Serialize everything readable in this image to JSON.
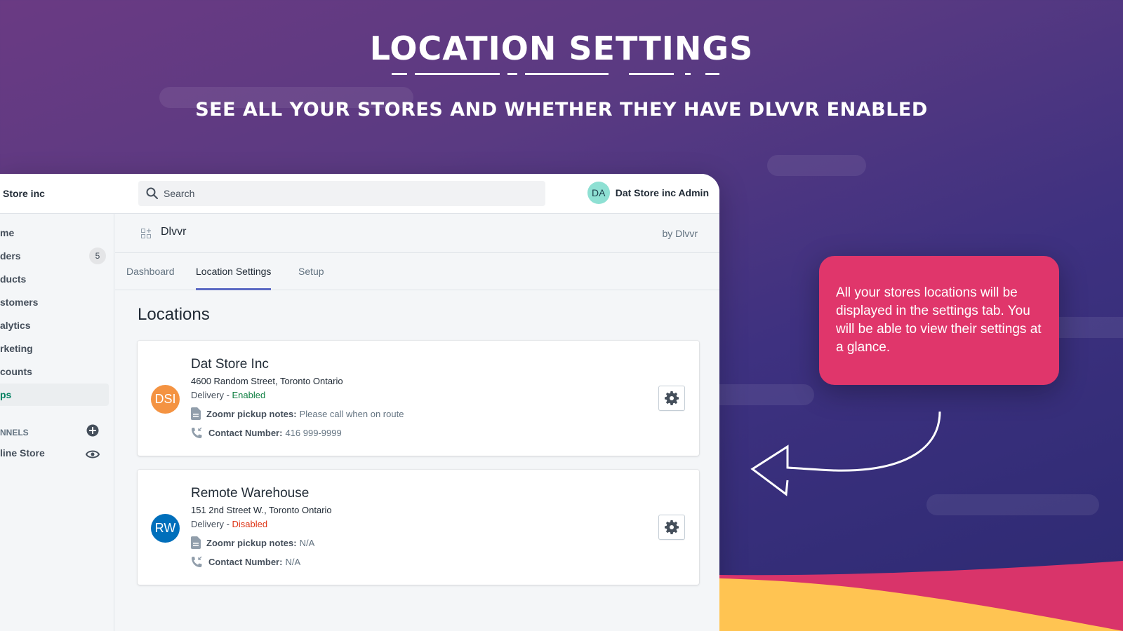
{
  "hero": {
    "title": "LOCATION SETTINGS",
    "subtitle": "SEE ALL YOUR STORES AND WHETHER THEY HAVE DLVVR ENABLED"
  },
  "topbar": {
    "store_name": "Store inc",
    "search_placeholder": "Search",
    "user_initials": "DA",
    "user_name": "Dat Store inc Admin"
  },
  "sidebar": {
    "items": [
      {
        "label": "me"
      },
      {
        "label": "ders",
        "badge": "5"
      },
      {
        "label": "ducts"
      },
      {
        "label": "stomers"
      },
      {
        "label": "alytics"
      },
      {
        "label": "rketing"
      },
      {
        "label": "counts"
      },
      {
        "label": "ps",
        "active": true
      }
    ],
    "section_label": "NNELS",
    "channel": "line Store"
  },
  "app": {
    "name": "Dlvvr",
    "by": "by Dlvvr",
    "tabs": [
      {
        "label": "Dashboard"
      },
      {
        "label": "Location Settings",
        "active": true
      },
      {
        "label": "Setup"
      }
    ],
    "page_title": "Locations",
    "locations": [
      {
        "initials": "DSI",
        "avatar_color": "#f49342",
        "name": "Dat Store Inc",
        "address": "4600 Random Street, Toronto Ontario",
        "delivery_label": "Delivery - ",
        "delivery_status": "Enabled",
        "notes_label": "Zoomr pickup notes:",
        "notes": "Please call when on route",
        "contact_label": "Contact Number:",
        "contact": "416 999-9999"
      },
      {
        "initials": "RW",
        "avatar_color": "#006fbb",
        "name": "Remote Warehouse",
        "address": "151 2nd Street W., Toronto Ontario",
        "delivery_label": "Delivery - ",
        "delivery_status": "Disabled",
        "notes_label": "Zoomr pickup notes:",
        "notes": "N/A",
        "contact_label": "Contact Number:",
        "contact": "N/A"
      }
    ]
  },
  "callout": {
    "text": "All your stores locations will be displayed in the settings tab. You will be able to view their settings at a glance."
  },
  "colors": {
    "callout": "#e0366b",
    "tab_active": "#5c6ac4",
    "enabled": "#108043",
    "disabled": "#de3618",
    "wave_yellow": "#ffc452",
    "wave_pink": "#d9346a"
  }
}
